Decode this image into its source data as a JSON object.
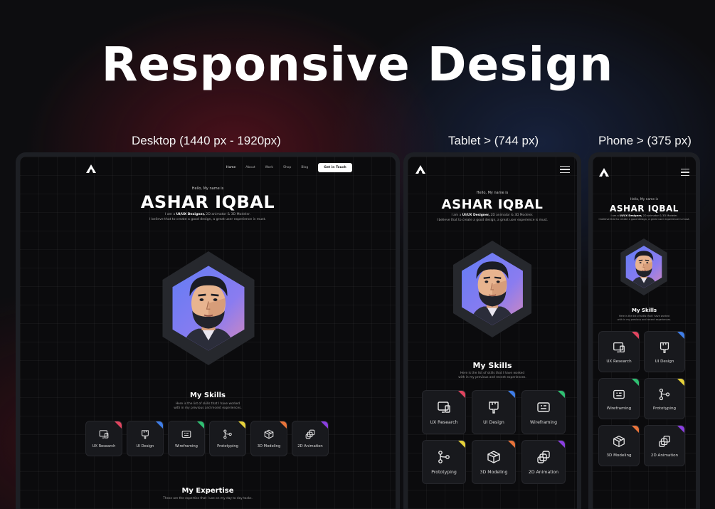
{
  "headline": "Responsive Design",
  "labels": {
    "desktop": "Desktop (1440 px - 1920px)",
    "tablet": "Tablet > (744 px)",
    "phone": "Phone > (375 px)"
  },
  "nav": {
    "items": [
      "Home",
      "About",
      "Work",
      "Shop",
      "Blog"
    ],
    "cta": "Get in Touch"
  },
  "hero": {
    "hello": "Hello, My name is",
    "name": "ASHAR IQBAL",
    "intro_pre": "I am a ",
    "intro_bold": "UI/UX Designer,",
    "intro_post": " 2D animator & 3D Modeler.",
    "intro_line2": "I believe that to create a good design, a great user experience is must."
  },
  "skills": {
    "title": "My Skills",
    "subtitle_1": "Here is the list of skills that I have worked",
    "subtitle_2": "with in my previous and recent experiences.",
    "items": [
      {
        "label": "UX Research",
        "icon": "ux-research-icon",
        "color": "#e0455f"
      },
      {
        "label": "UI Design",
        "icon": "ui-design-icon",
        "color": "#3f7ee8"
      },
      {
        "label": "Wireframing",
        "icon": "wireframing-icon",
        "color": "#2fbf71"
      },
      {
        "label": "Prototyping",
        "icon": "prototyping-icon",
        "color": "#e6d23a"
      },
      {
        "label": "3D Modeling",
        "icon": "cube-icon",
        "color": "#e8733a"
      },
      {
        "label": "2D Animation",
        "icon": "animation-icon",
        "color": "#8a3fe0"
      }
    ]
  },
  "expertise": {
    "title": "My Expertise",
    "subtitle": "These are the expertise that I use on my day to day tasks."
  }
}
